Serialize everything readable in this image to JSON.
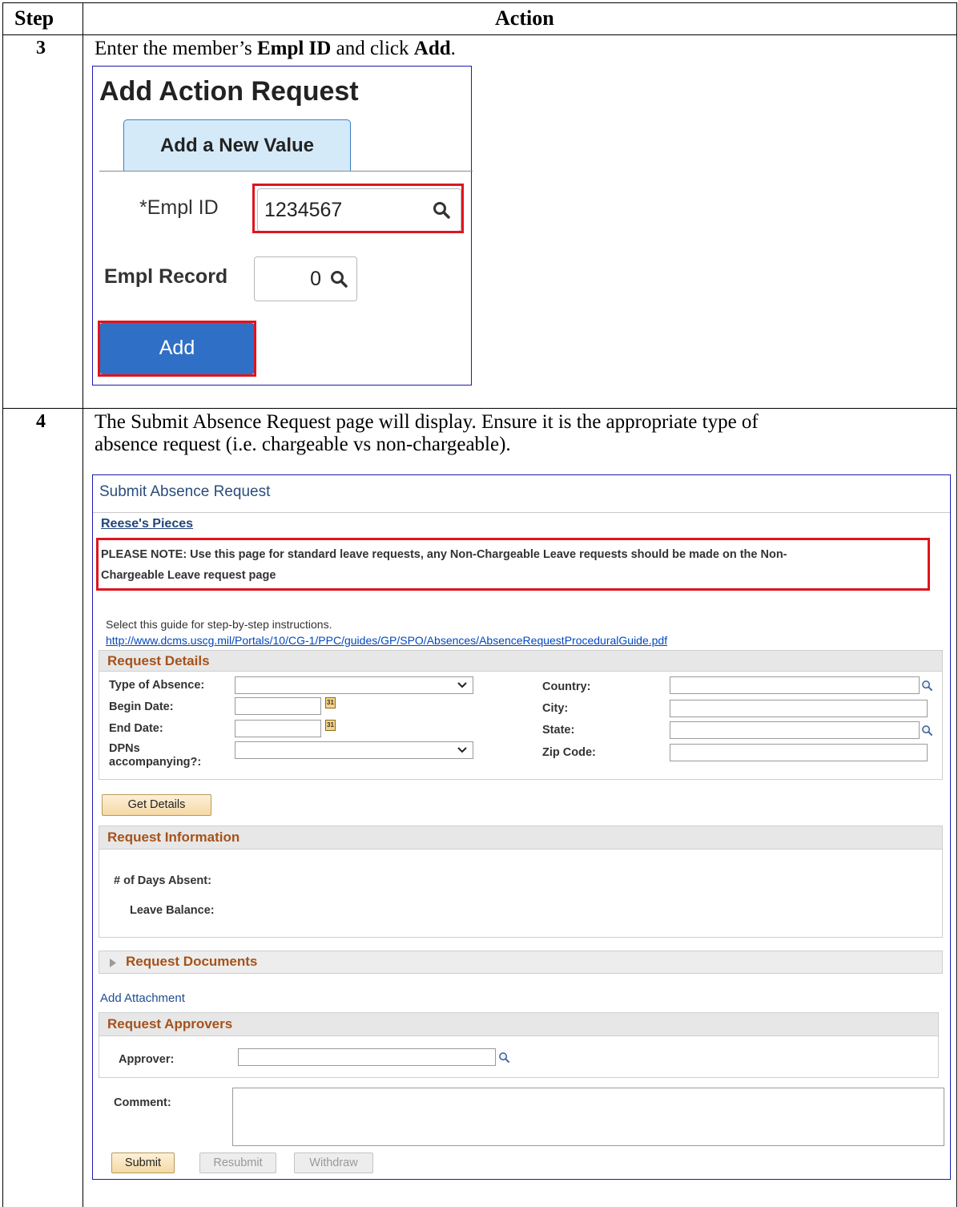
{
  "table": {
    "header_step": "Step",
    "header_action": "Action"
  },
  "step3": {
    "number": "3",
    "text_before": "Enter the member’s ",
    "bold1": "Empl ID",
    "text_mid": " and click ",
    "bold2": "Add",
    "text_after": ".",
    "panel": {
      "title": "Add Action Request",
      "tab_label": "Add a New Value",
      "empl_id_label": "*Empl ID",
      "empl_id_value": "1234567",
      "empl_record_label": "Empl Record",
      "empl_record_value": "0",
      "add_button": "Add"
    }
  },
  "step4": {
    "number": "4",
    "text_line1": "The Submit Absence Request page will display.  Ensure it is the appropriate type of",
    "text_line2": "absence request (i.e. chargeable vs non-chargeable).",
    "panel": {
      "title": "Submit Absence Request",
      "person_name": "Reese's Pieces",
      "note_line1": "PLEASE NOTE: Use this page for standard leave requests, any Non-Chargeable Leave requests should be made on the Non-",
      "note_line2": "Chargeable Leave request page",
      "guide_text": "Select this guide for step-by-step instructions.",
      "guide_link": "http://www.dcms.uscg.mil/Portals/10/CG-1/PPC/guides/GP/SPO/Absences/AbsenceRequestProceduralGuide.pdf",
      "request_details": {
        "heading": "Request Details",
        "type_of_absence": "Type of Absence:",
        "begin_date": "Begin Date:",
        "end_date": "End Date:",
        "dpns_line1": "DPNs",
        "dpns_line2": "accompanying?:",
        "country": "Country:",
        "city": "City:",
        "state": "State:",
        "zip_code": "Zip Code:"
      },
      "get_details_button": "Get Details",
      "request_information": {
        "heading": "Request Information",
        "days_absent": "# of Days Absent:",
        "leave_balance": "Leave Balance:"
      },
      "request_documents": {
        "heading": "Request Documents"
      },
      "add_attachment": "Add Attachment",
      "request_approvers": {
        "heading": "Request Approvers",
        "approver": "Approver:"
      },
      "comment_label": "Comment:",
      "submit_button": "Submit",
      "resubmit_button": "Resubmit",
      "withdraw_button": "Withdraw"
    }
  },
  "colors": {
    "highlight_red": "#e0141e",
    "add_button_blue": "#2f70c6",
    "section_heading_orange": "#a5521a",
    "panel_border_blue": "#1a1ab3"
  },
  "icons": [
    "search-icon",
    "calendar-icon",
    "chevron-down-icon",
    "triangle-right-icon"
  ]
}
